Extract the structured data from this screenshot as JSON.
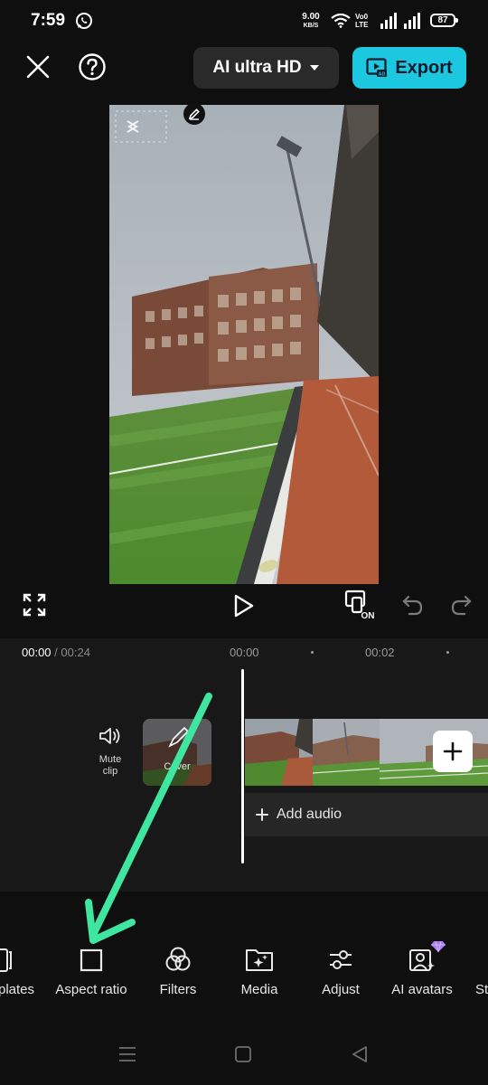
{
  "status_bar": {
    "time": "7:59",
    "net_speed_value": "9.00",
    "net_speed_unit": "KB/S",
    "volte_line1": "Vo0",
    "volte_line2": "LTE",
    "battery": "87"
  },
  "header": {
    "quality_label": "AI ultra HD",
    "export_label": "Export"
  },
  "preview": {
    "watermark_icon": "capcut-logo-icon"
  },
  "timeline": {
    "current_time": "00:00",
    "separator": " / ",
    "total_time": "00:24",
    "ticks": [
      "00:00",
      "00:02"
    ],
    "mute_label_line1": "Mute",
    "mute_label_line2": "clip",
    "cover_label": "Cover",
    "add_audio_label": "Add audio"
  },
  "toolbar": {
    "items": [
      {
        "label": "plates",
        "icon": "templates-icon"
      },
      {
        "label": "Aspect ratio",
        "icon": "aspect-ratio-icon"
      },
      {
        "label": "Filters",
        "icon": "filters-icon"
      },
      {
        "label": "Media",
        "icon": "media-icon"
      },
      {
        "label": "Adjust",
        "icon": "adjust-icon"
      },
      {
        "label": "AI avatars",
        "icon": "ai-avatars-icon"
      },
      {
        "label": "St",
        "icon": "stickers-icon"
      }
    ]
  },
  "colors": {
    "accent": "#1cc8e0",
    "annotation": "#3ee6a0",
    "background": "#0f0f0f"
  }
}
